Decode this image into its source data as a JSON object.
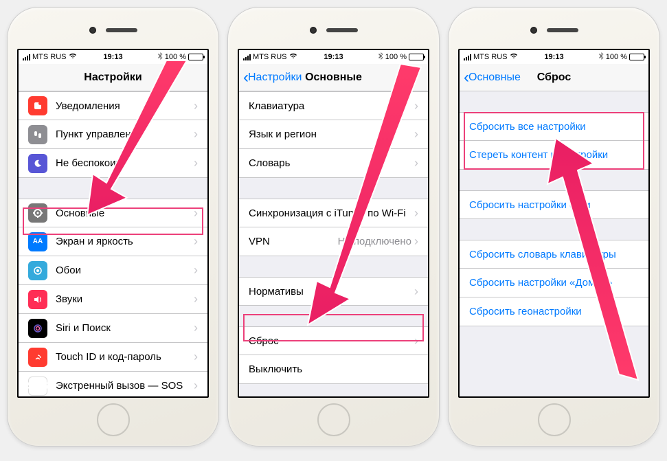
{
  "statusbar": {
    "carrier": "MTS RUS",
    "time": "19:13",
    "battery_pct": "100 %"
  },
  "screen1": {
    "title": "Настройки",
    "items": [
      {
        "label": "Уведомления"
      },
      {
        "label": "Пункт управления"
      },
      {
        "label": "Не беспокоить"
      },
      {
        "label": "Основные"
      },
      {
        "label": "Экран и яркость"
      },
      {
        "label": "Обои"
      },
      {
        "label": "Звуки"
      },
      {
        "label": "Siri и Поиск"
      },
      {
        "label": "Touch ID и код-пароль"
      },
      {
        "label": "Экстренный вызов — SOS"
      }
    ]
  },
  "screen2": {
    "back": "Настройки",
    "title": "Основные",
    "group1": [
      {
        "label": "Клавиатура"
      },
      {
        "label": "Язык и регион"
      },
      {
        "label": "Словарь"
      }
    ],
    "group2": [
      {
        "label": "Синхронизация с iTunes по Wi-Fi"
      },
      {
        "label": "VPN",
        "detail": "Не подключено"
      }
    ],
    "group3": [
      {
        "label": "Нормативы"
      }
    ],
    "group4": [
      {
        "label": "Сброс"
      },
      {
        "label": "Выключить"
      }
    ]
  },
  "screen3": {
    "back": "Основные",
    "title": "Сброс",
    "group1": [
      {
        "label": "Сбросить все настройки"
      },
      {
        "label": "Стереть контент и настройки"
      }
    ],
    "group2": [
      {
        "label": "Сбросить настройки сети"
      }
    ],
    "group3": [
      {
        "label": "Сбросить словарь клавиатуры"
      },
      {
        "label": "Сбросить настройки «Домой»"
      },
      {
        "label": "Сбросить геонастройки"
      }
    ]
  }
}
